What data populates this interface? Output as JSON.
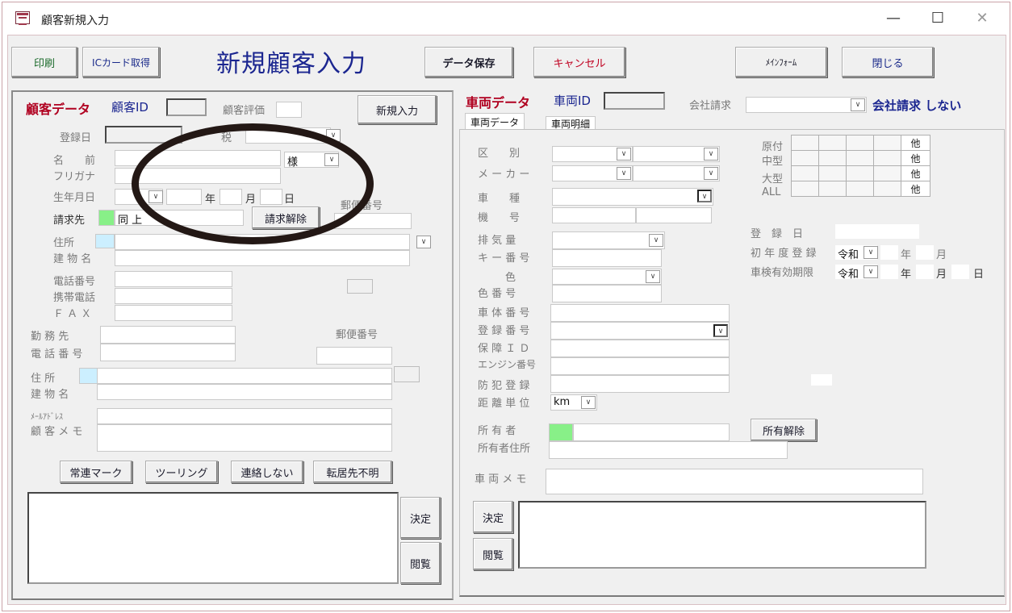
{
  "window": {
    "title": "顧客新規入力",
    "controls": {
      "minimize": "—",
      "maximize": "☐",
      "close": "✕"
    }
  },
  "toolbar": {
    "print": "印刷",
    "ic_card": "ICカード取得",
    "heading": "新規顧客入力",
    "save": "データ保存",
    "cancel": "キャンセル",
    "main_form": "ﾒｲﾝﾌｫｰﾑ",
    "close": "閉じる"
  },
  "customer": {
    "section_title": "顧客データ",
    "id_label": "顧客ID",
    "rating_label": "顧客評価",
    "new_entry_button": "新規入力",
    "reg_date_label": "登録日",
    "tax_label": "税",
    "name_label": "名　　前",
    "honorific": "様",
    "furigana_label": "フリガナ",
    "birth_label": "生年月日",
    "year": "年",
    "month": "月",
    "day": "日",
    "postal_label": "郵便番号",
    "billing_label": "請求先",
    "billing_value": "同 上",
    "billing_release": "請求解除",
    "address_label": "住所",
    "building_label": "建 物 名",
    "phone_label": "電話番号",
    "mobile_label": "携帯電話",
    "fax_label": "Ｆ Ａ Ｘ",
    "work_label": "勤 務 先",
    "work_phone_label": "電 話 番 号",
    "work_postal_label": "郵便番号",
    "work_address_label": "住 所",
    "work_building_label": "建 物 名",
    "email_label": "ﾒｰﾙｱﾄﾞﾚｽ",
    "memo_label": "顧 客 メ モ",
    "buttons": [
      "常連マーク",
      "ツーリング",
      "連絡しない",
      "転居先不明"
    ],
    "decide": "決定",
    "browse": "閲覧"
  },
  "vehicle": {
    "section_title": "車両データ",
    "id_label": "車両ID",
    "company_billing_label": "会社請求",
    "company_billing_status": "会社請求 しない",
    "tabs": [
      "車両データ",
      "車両明細"
    ],
    "classification": "区　　別",
    "maker": "メ ー カ ー",
    "model": "車　　種",
    "machine_no": "機　　号",
    "displacement": "排 気 量",
    "key_no": "キ ー 番 号",
    "color": "色",
    "color_no": "色 番 号",
    "frame_no": "車 体 番 号",
    "reg_no": "登 録 番 号",
    "warranty_id": "保 障 Ｉ Ｄ",
    "engine_no": "エンジン番号",
    "theft_reg": "防 犯 登 録",
    "distance_unit": "距 離 単 位",
    "distance_unit_value": "km",
    "owner": "所 有 者",
    "owner_address": "所有者住所",
    "owner_release": "所有解除",
    "memo": "車 両 メ モ",
    "grid_rows": [
      "原付",
      "中型",
      "大型",
      "ALL"
    ],
    "grid_other": "他",
    "reg_date": "登　録　日",
    "first_reg": "初 年 度 登 録",
    "inspection": "車検有効期限",
    "era": "令和",
    "year": "年",
    "month": "月",
    "day": "日",
    "decide": "決定",
    "browse": "閲覧"
  }
}
